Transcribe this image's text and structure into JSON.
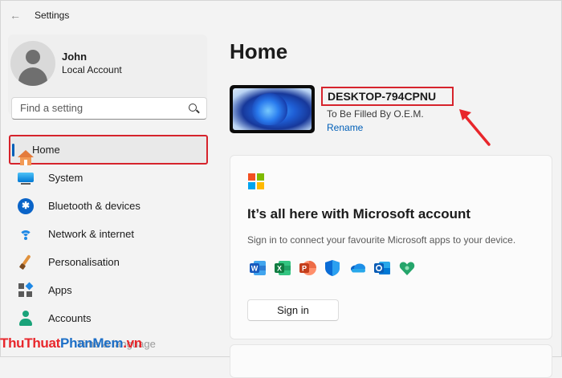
{
  "window": {
    "title": "Settings"
  },
  "profile": {
    "name": "John",
    "account_type": "Local Account"
  },
  "search": {
    "placeholder": "Find a setting"
  },
  "nav": [
    {
      "label": "Home",
      "icon": "home-icon",
      "active": true
    },
    {
      "label": "System",
      "icon": "monitor-icon"
    },
    {
      "label": "Bluetooth & devices",
      "icon": "bluetooth-icon"
    },
    {
      "label": "Network & internet",
      "icon": "wifi-icon"
    },
    {
      "label": "Personalisation",
      "icon": "paintbrush-icon"
    },
    {
      "label": "Apps",
      "icon": "apps-icon"
    },
    {
      "label": "Accounts",
      "icon": "person-icon"
    }
  ],
  "nav_partial": "Time & language",
  "main": {
    "title": "Home",
    "device": {
      "name": "DESKTOP-794CPNU",
      "model": "To Be Filled By O.E.M.",
      "rename": "Rename"
    },
    "card": {
      "title": "It’s all here with Microsoft account",
      "description": "Sign in to connect your favourite Microsoft apps to your device.",
      "apps": [
        "word-icon",
        "excel-icon",
        "powerpoint-icon",
        "defender-icon",
        "onedrive-icon",
        "outlook-icon",
        "family-safety-icon"
      ],
      "signin": "Sign in"
    }
  },
  "watermark": {
    "part1": "ThuThuat",
    "part2": "PhanMem",
    "part3": ".vn"
  },
  "colors": {
    "accent": "#005fb8",
    "highlight": "#d6232c"
  }
}
